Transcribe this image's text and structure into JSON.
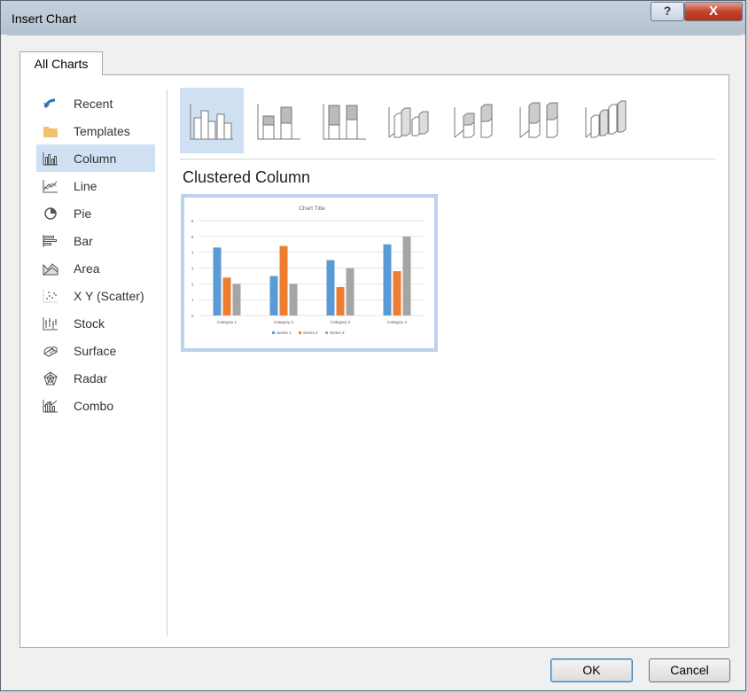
{
  "window": {
    "title": "Insert Chart",
    "help_glyph": "?",
    "close_glyph": "X"
  },
  "tabs": [
    {
      "label": "All Charts"
    }
  ],
  "chart_types": [
    {
      "label": "Recent",
      "icon": "recent-icon"
    },
    {
      "label": "Templates",
      "icon": "folder-icon"
    },
    {
      "label": "Column",
      "icon": "column-chart-icon",
      "selected": true
    },
    {
      "label": "Line",
      "icon": "line-chart-icon"
    },
    {
      "label": "Pie",
      "icon": "pie-chart-icon"
    },
    {
      "label": "Bar",
      "icon": "bar-chart-icon"
    },
    {
      "label": "Area",
      "icon": "area-chart-icon"
    },
    {
      "label": "X Y (Scatter)",
      "icon": "scatter-chart-icon"
    },
    {
      "label": "Stock",
      "icon": "stock-chart-icon"
    },
    {
      "label": "Surface",
      "icon": "surface-chart-icon"
    },
    {
      "label": "Radar",
      "icon": "radar-chart-icon"
    },
    {
      "label": "Combo",
      "icon": "combo-chart-icon"
    }
  ],
  "subtypes": [
    "Clustered Column",
    "Stacked Column",
    "100% Stacked Column",
    "3-D Clustered Column",
    "3-D Stacked Column",
    "3-D 100% Stacked Column",
    "3-D Column"
  ],
  "selected_subtype_title": "Clustered Column",
  "preview": {
    "chart_data": {
      "type": "bar",
      "title": "Chart Title",
      "categories": [
        "Category 1",
        "Category 2",
        "Category 3",
        "Category 4"
      ],
      "series": [
        {
          "name": "Series 1",
          "values": [
            4.3,
            2.5,
            3.5,
            4.5
          ],
          "color": "#5b9bd5"
        },
        {
          "name": "Series 2",
          "values": [
            2.4,
            4.4,
            1.8,
            2.8
          ],
          "color": "#ed7d31"
        },
        {
          "name": "Series 3",
          "values": [
            2,
            2,
            3,
            5
          ],
          "color": "#a5a5a5"
        }
      ],
      "ylim": [
        0,
        6
      ],
      "yticks": [
        "0",
        "1",
        "2",
        "3",
        "4",
        "5",
        "6"
      ],
      "grid": true,
      "legend_position": "bottom"
    }
  },
  "buttons": {
    "ok": "OK",
    "cancel": "Cancel"
  }
}
